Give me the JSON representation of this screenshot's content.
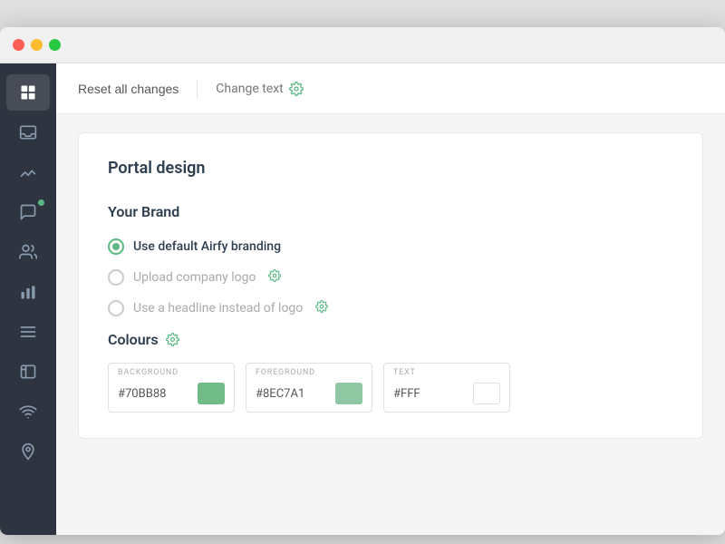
{
  "window": {
    "title": "Portal Design"
  },
  "traffic_lights": {
    "red": "close",
    "yellow": "minimize",
    "green": "maximize"
  },
  "toolbar": {
    "reset_label": "Reset all changes",
    "change_text_label": "Change text"
  },
  "sidebar": {
    "items": [
      {
        "name": "dashboard",
        "icon": "grid",
        "active": true
      },
      {
        "name": "inbox",
        "icon": "inbox",
        "active": false
      },
      {
        "name": "analytics",
        "icon": "chart-line",
        "active": false
      },
      {
        "name": "messages",
        "icon": "chat",
        "active": false,
        "badge": true
      },
      {
        "name": "contacts",
        "icon": "users",
        "active": false
      },
      {
        "name": "reports",
        "icon": "bar-chart",
        "active": false
      },
      {
        "name": "list",
        "icon": "list",
        "active": false
      },
      {
        "name": "portal",
        "icon": "portal",
        "active": false
      },
      {
        "name": "wifi",
        "icon": "wifi",
        "active": false
      },
      {
        "name": "location",
        "icon": "pin",
        "active": false
      }
    ]
  },
  "card": {
    "title": "Portal design",
    "brand_section": {
      "title": "Your Brand",
      "options": [
        {
          "id": "default",
          "label": "Use default Airfy branding",
          "checked": true,
          "disabled": false,
          "has_gear": false
        },
        {
          "id": "logo",
          "label": "Upload company logo",
          "checked": false,
          "disabled": true,
          "has_gear": true
        },
        {
          "id": "headline",
          "label": "Use a headline instead of logo",
          "checked": false,
          "disabled": true,
          "has_gear": true
        }
      ]
    },
    "colours_section": {
      "title": "Colours",
      "has_gear": true,
      "fields": [
        {
          "label": "BACKGROUND",
          "value": "#70BB88",
          "swatch": "#70BB88"
        },
        {
          "label": "FOREGROUND",
          "value": "#8EC7A1",
          "swatch": "#8EC7A1"
        },
        {
          "label": "TEXT",
          "value": "#FFF",
          "swatch": "#FFFFFF"
        }
      ]
    }
  }
}
